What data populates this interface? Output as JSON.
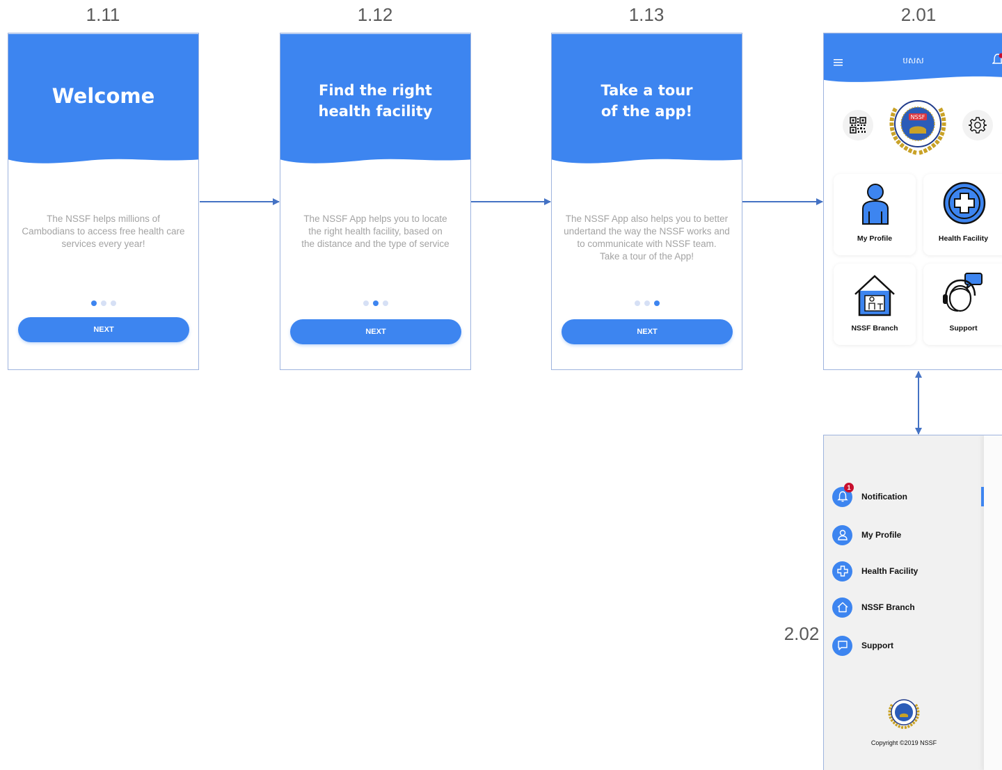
{
  "labels": {
    "s111": "1.11",
    "s112": "1.12",
    "s113": "1.13",
    "s201": "2.01",
    "s202": "2.02"
  },
  "onboarding": [
    {
      "title_line1": "Welcome",
      "title_line2": "",
      "text": [
        "The NSSF helps millions of",
        "Cambodians to access free health care",
        "services every year!"
      ],
      "active_dot": 0,
      "button": "NEXT"
    },
    {
      "title_line1": "Find the right",
      "title_line2": "health facility",
      "text": [
        "The NSSF App helps you to locate",
        "the right health facility, based on",
        "the distance and the type of service"
      ],
      "active_dot": 1,
      "button": "NEXT"
    },
    {
      "title_line1": "Take a tour",
      "title_line2": "of the app!",
      "text": [
        "The NSSF App also helps you to better",
        "undertand the way the NSSF works and",
        "to communicate with NSSF team.",
        "Take a tour of the App!"
      ],
      "active_dot": 2,
      "button": "NEXT"
    }
  ],
  "home": {
    "header_title": "បសស",
    "logo_text": "NSSF",
    "tiles": [
      {
        "label": "My Profile",
        "icon": "person-icon"
      },
      {
        "label": "Health Facility",
        "icon": "medical-cross-icon"
      },
      {
        "label": "NSSF Branch",
        "icon": "house-icon"
      },
      {
        "label": "Support",
        "icon": "headset-icon"
      }
    ]
  },
  "drawer": {
    "items": [
      {
        "label": "Notification",
        "icon": "bell-icon",
        "badge": "1"
      },
      {
        "label": "My Profile",
        "icon": "person-icon"
      },
      {
        "label": "Health Facility",
        "icon": "medical-cross-icon"
      },
      {
        "label": "NSSF Branch",
        "icon": "house-icon"
      },
      {
        "label": "Support",
        "icon": "chat-icon"
      }
    ],
    "copyright": "Copyright ©2019 NSSF"
  },
  "colors": {
    "primary": "#3d85f0",
    "arrow": "#4472c4",
    "badge": "#c8102e",
    "gold": "#c9a227",
    "navy": "#1f3a8a"
  }
}
